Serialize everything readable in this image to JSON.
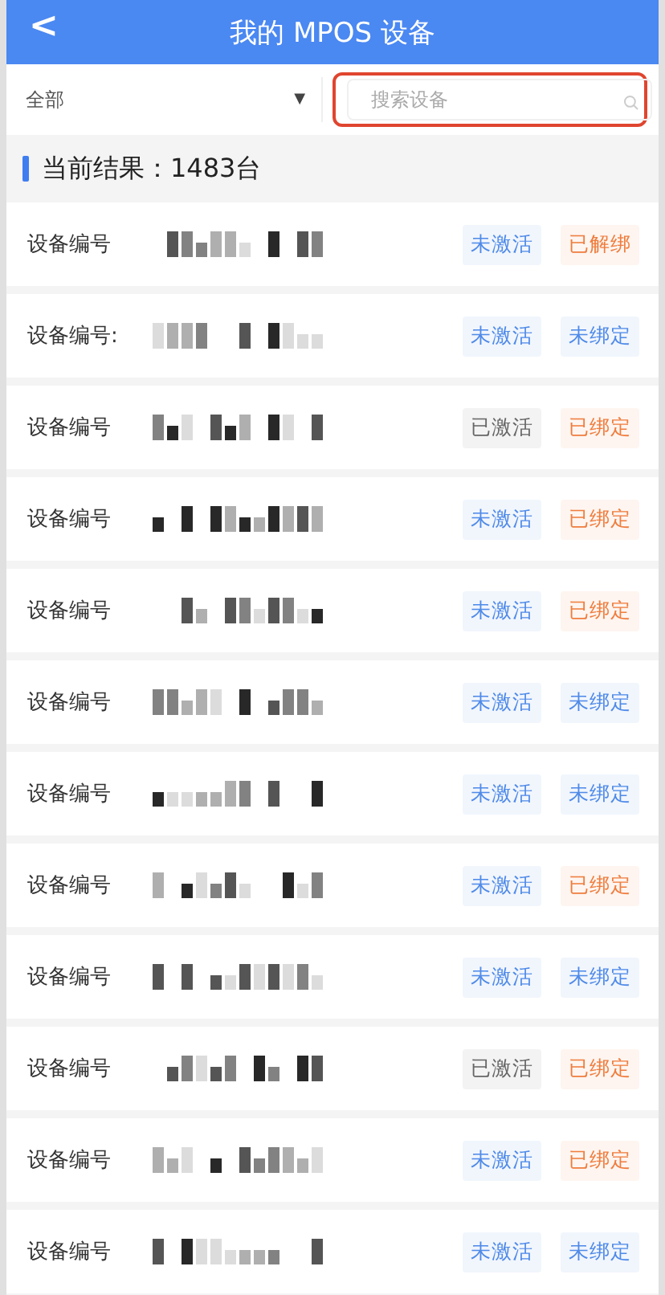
{
  "header": {
    "back": "<",
    "title": "我的 MPOS 设备"
  },
  "filter": {
    "value": "全部",
    "caret": "▼"
  },
  "search": {
    "placeholder": "搜索设备",
    "highlighted": true
  },
  "result": {
    "text": "当前结果：1483台"
  },
  "devices": [
    {
      "label": "设备编号",
      "tags": [
        {
          "text": "未激活",
          "color": "#4f8ae8"
        },
        {
          "text": "已解绑",
          "color": "#ef7d3e"
        }
      ]
    },
    {
      "label": "设备编号:",
      "tags": [
        {
          "text": "未激活",
          "color": "#4f8ae8"
        },
        {
          "text": "未绑定",
          "color": "#4f8ae8"
        }
      ]
    },
    {
      "label": "设备编号",
      "tags": [
        {
          "text": "已激活",
          "color": "#666666"
        },
        {
          "text": "已绑定",
          "color": "#ef7d3e"
        }
      ]
    },
    {
      "label": "设备编号",
      "tags": [
        {
          "text": "未激活",
          "color": "#4f8ae8"
        },
        {
          "text": "已绑定",
          "color": "#ef7d3e"
        }
      ]
    },
    {
      "label": "设备编号",
      "tags": [
        {
          "text": "未激活",
          "color": "#4f8ae8"
        },
        {
          "text": "已绑定",
          "color": "#ef7d3e"
        }
      ]
    },
    {
      "label": "设备编号",
      "tags": [
        {
          "text": "未激活",
          "color": "#4f8ae8"
        },
        {
          "text": "未绑定",
          "color": "#4f8ae8"
        }
      ]
    },
    {
      "label": "设备编号",
      "tags": [
        {
          "text": "未激活",
          "color": "#4f8ae8"
        },
        {
          "text": "未绑定",
          "color": "#4f8ae8"
        }
      ]
    },
    {
      "label": "设备编号",
      "tags": [
        {
          "text": "未激活",
          "color": "#4f8ae8"
        },
        {
          "text": "已绑定",
          "color": "#ef7d3e"
        }
      ]
    },
    {
      "label": "设备编号",
      "tags": [
        {
          "text": "未激活",
          "color": "#4f8ae8"
        },
        {
          "text": "未绑定",
          "color": "#4f8ae8"
        }
      ]
    },
    {
      "label": "设备编号",
      "tags": [
        {
          "text": "已激活",
          "color": "#666666"
        },
        {
          "text": "已绑定",
          "color": "#ef7d3e"
        }
      ]
    },
    {
      "label": "设备编号",
      "tags": [
        {
          "text": "未激活",
          "color": "#4f8ae8"
        },
        {
          "text": "已绑定",
          "color": "#ef7d3e"
        }
      ]
    },
    {
      "label": "设备编号",
      "tags": [
        {
          "text": "未激活",
          "color": "#4f8ae8"
        },
        {
          "text": "未绑定",
          "color": "#4f8ae8"
        }
      ]
    }
  ]
}
